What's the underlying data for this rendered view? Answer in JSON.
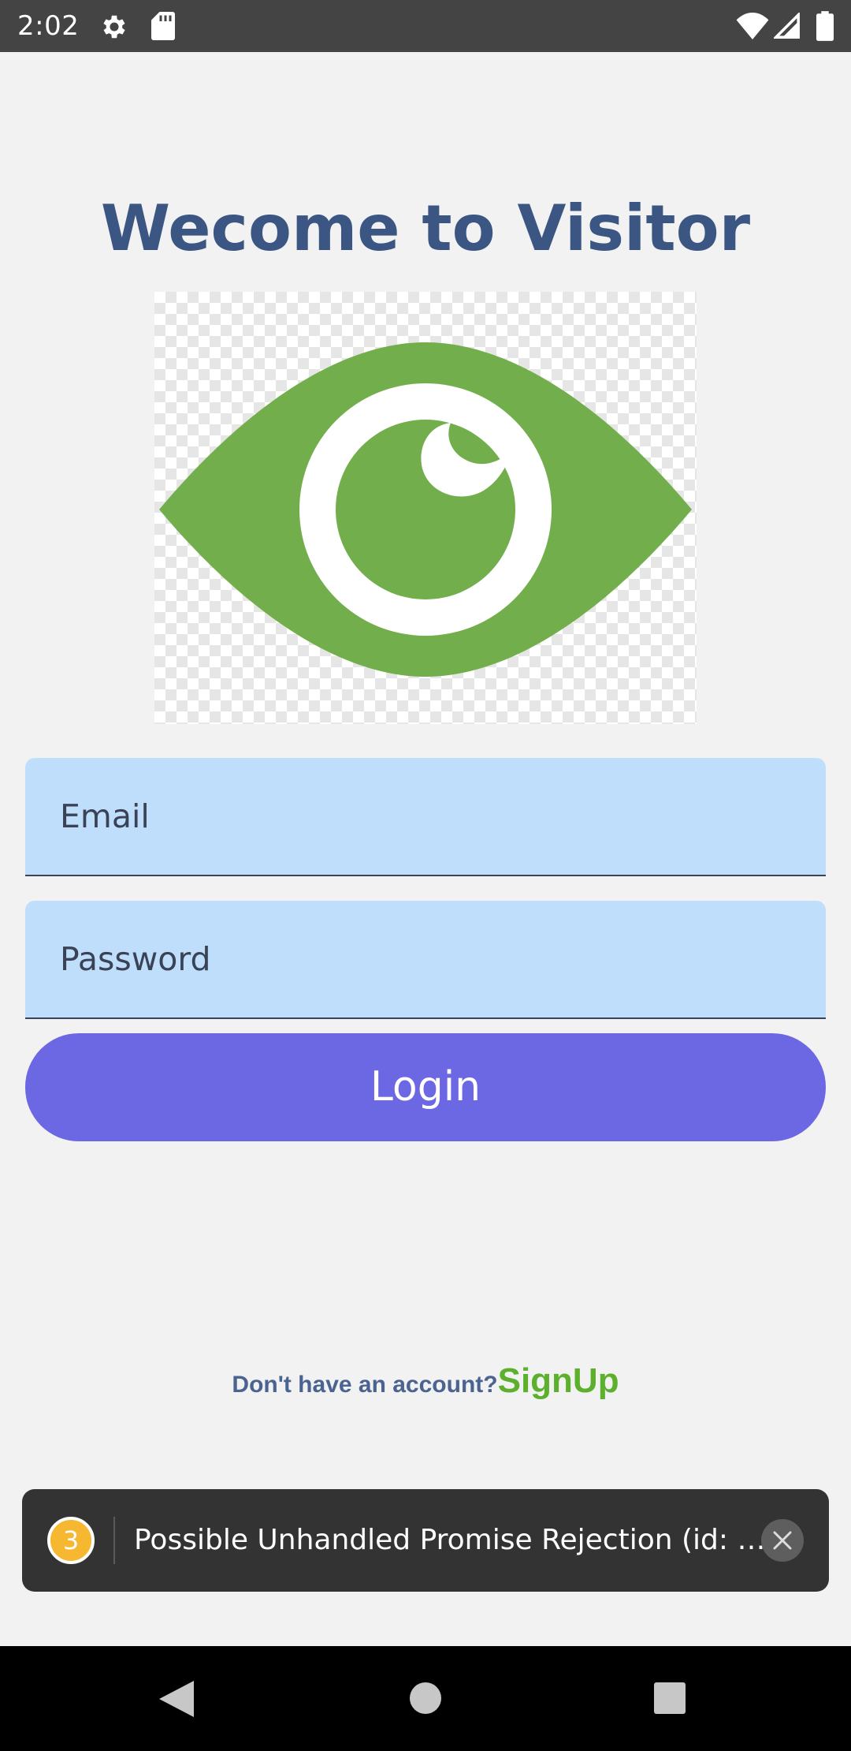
{
  "status_bar": {
    "time": "2:02",
    "icons": [
      "gear-icon",
      "sd-card-icon",
      "wifi-icon",
      "cell-signal-icon",
      "battery-icon"
    ]
  },
  "header": {
    "title": "Wecome to Visitor"
  },
  "logo": {
    "icon": "eye-icon",
    "color": "#72ae4b"
  },
  "form": {
    "email_placeholder": "Email",
    "password_placeholder": "Password",
    "login_label": "Login"
  },
  "signup": {
    "prompt": "Don't have an account?",
    "link_label": "SignUp"
  },
  "toast": {
    "count": "3",
    "message": "Possible Unhandled Promise Rejection (id: …"
  },
  "nav_bar": {
    "icons": [
      "back-icon",
      "home-icon",
      "recents-icon"
    ]
  },
  "colors": {
    "title": "#3b5682",
    "field_bg": "#bfdefc",
    "button": "#6c68e3",
    "signup_link": "#5db02d",
    "badge": "#f6b731"
  }
}
